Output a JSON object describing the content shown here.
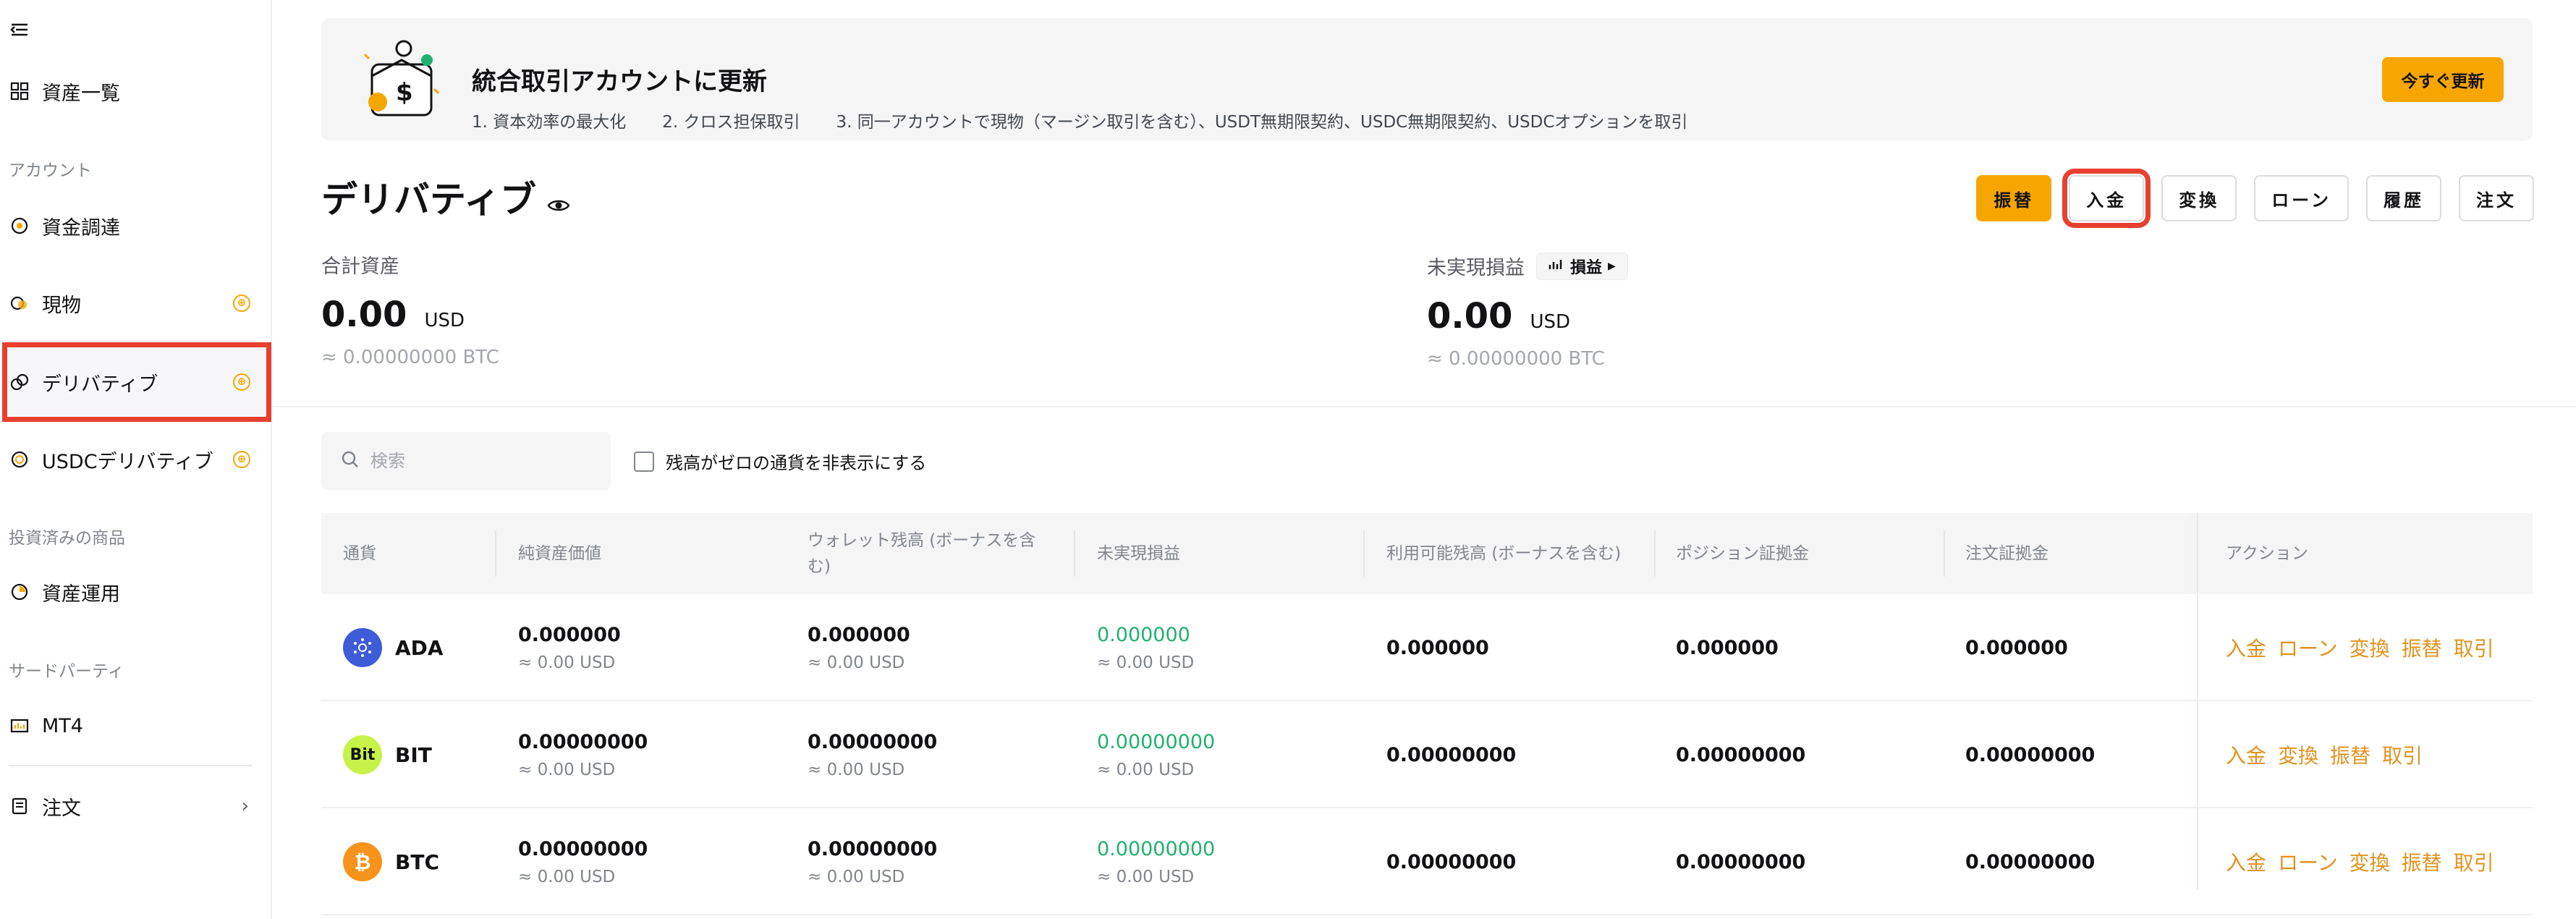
{
  "sidebar": {
    "toggle_icon": "menu-collapse-icon",
    "items": [
      {
        "label": "資産一覧",
        "icon": "grid-icon"
      },
      {
        "label": "資金調達",
        "icon": "coin-circle-icon"
      },
      {
        "label": "現物",
        "icon": "spot-icon"
      },
      {
        "label": "デリバティブ",
        "icon": "derivatives-icon"
      },
      {
        "label": "USDCデリバティブ",
        "icon": "usdc-icon"
      },
      {
        "label": "資産運用",
        "icon": "earn-icon"
      },
      {
        "label": "MT4",
        "icon": "mt4-icon"
      },
      {
        "label": "注文",
        "icon": "order-icon"
      }
    ],
    "sections": [
      "アカウント",
      "投資済みの商品",
      "サードパーティ"
    ],
    "badge_symbol": "⊕",
    "chevron": "›"
  },
  "banner": {
    "title": "統合取引アカウントに更新",
    "points": [
      "1. 資本効率の最大化",
      "2. クロス担保取引",
      "3. 同一アカウントで現物（マージン取引を含む）、USDT無期限契約、USDC無期限契約、USDCオプションを取引"
    ],
    "button": "今すぐ更新"
  },
  "header": {
    "title": "デリバティブ",
    "actions": [
      "振替",
      "入金",
      "変換",
      "ローン",
      "履歴",
      "注文"
    ]
  },
  "total_assets": {
    "label": "合計資産",
    "value": "0.00",
    "unit": "USD",
    "btc": "≈ 0.00000000 BTC"
  },
  "unrealized": {
    "label": "未実現損益",
    "chip": "損益",
    "value": "0.00",
    "unit": "USD",
    "btc": "≈ 0.00000000 BTC"
  },
  "filters": {
    "search_placeholder": "検索",
    "hide_zero_label": "残高がゼロの通貨を非表示にする"
  },
  "table": {
    "headers": [
      "通貨",
      "純資産価値",
      "ウォレット残高 (ボーナスを含む)",
      "未実現損益",
      "利用可能残高 (ボーナスを含む)",
      "ポジション証拠金",
      "注文証拠金",
      "アクション"
    ],
    "rows": [
      {
        "coin": "ADA",
        "logo_color": "#3e5bd8",
        "equity": "0.000000",
        "equity_usd": "≈ 0.00 USD",
        "wallet": "0.000000",
        "wallet_usd": "≈ 0.00 USD",
        "upnl": "0.000000",
        "upnl_usd": "≈ 0.00 USD",
        "available": "0.000000",
        "position_margin": "0.000000",
        "order_margin": "0.000000",
        "actions": [
          "入金",
          "ローン",
          "変換",
          "振替",
          "取引"
        ]
      },
      {
        "coin": "BIT",
        "logo_color": "#c7f24a",
        "equity": "0.00000000",
        "equity_usd": "≈ 0.00 USD",
        "wallet": "0.00000000",
        "wallet_usd": "≈ 0.00 USD",
        "upnl": "0.00000000",
        "upnl_usd": "≈ 0.00 USD",
        "available": "0.00000000",
        "position_margin": "0.00000000",
        "order_margin": "0.00000000",
        "actions": [
          "入金",
          "変換",
          "振替",
          "取引"
        ]
      },
      {
        "coin": "BTC",
        "logo_color": "#f7931a",
        "equity": "0.00000000",
        "equity_usd": "≈ 0.00 USD",
        "wallet": "0.00000000",
        "wallet_usd": "≈ 0.00 USD",
        "upnl": "0.00000000",
        "upnl_usd": "≈ 0.00 USD",
        "available": "0.00000000",
        "position_margin": "0.00000000",
        "order_margin": "0.00000000",
        "actions": [
          "入金",
          "ローン",
          "変換",
          "振替",
          "取引"
        ]
      }
    ]
  },
  "colors": {
    "accent": "#f7a600",
    "highlight": "#e8402f",
    "positive": "#20b26c",
    "link": "#e2921c"
  }
}
